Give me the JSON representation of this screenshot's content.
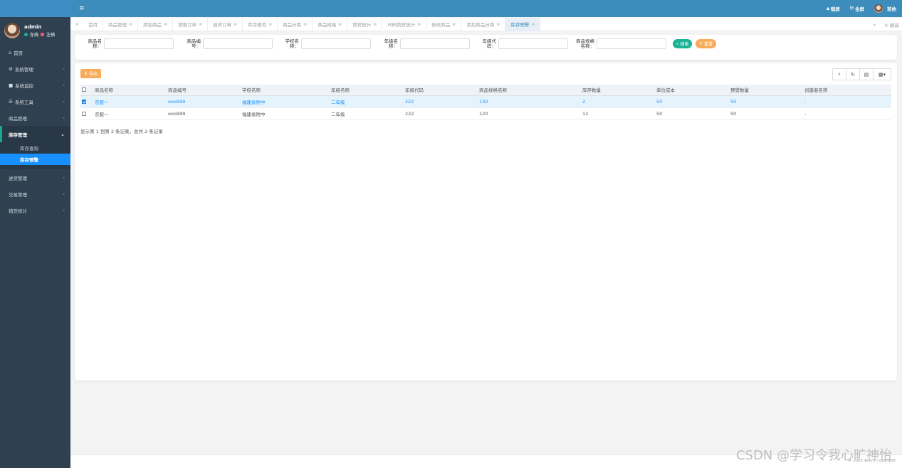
{
  "header": {
    "lock_label": "锁屏",
    "fullscreen_label": "全屏",
    "user_label": "若依"
  },
  "user": {
    "name": "admin",
    "status_online": "在线",
    "logout_label": "注销"
  },
  "sidebar": {
    "items": [
      {
        "icon": "home-icon",
        "label": "首页",
        "glyph": "⌂"
      },
      {
        "icon": "gear-icon",
        "label": "系统管理",
        "glyph": "⚙"
      },
      {
        "icon": "monitor-icon",
        "label": "系统监控",
        "glyph": "■"
      },
      {
        "icon": "tools-icon",
        "label": "系统工具",
        "glyph": "☰"
      },
      {
        "icon": "",
        "label": "商品管理",
        "glyph": ""
      },
      {
        "icon": "",
        "label": "库存管理",
        "glyph": ""
      },
      {
        "icon": "",
        "label": "进货管理",
        "glyph": ""
      },
      {
        "icon": "",
        "label": "交易管理",
        "glyph": ""
      },
      {
        "icon": "",
        "label": "销货统计",
        "glyph": ""
      }
    ],
    "sub_items": [
      "库存查询",
      "库存预警"
    ]
  },
  "tabs": {
    "items": [
      "首页",
      "商品管理",
      "添加商品",
      "销售订单",
      "退货订单",
      "库存查询",
      "商品分类",
      "商品规格",
      "销货统计",
      "尺码销货统计",
      "修改商品",
      "添加商品分类",
      "库存预警"
    ],
    "refresh_label": "刷新"
  },
  "search": {
    "fields": [
      {
        "label": "商品名称：",
        "value": ""
      },
      {
        "label": "商品编号：",
        "value": ""
      },
      {
        "label": "学校名称：",
        "value": ""
      },
      {
        "label": "年级名称：",
        "value": ""
      },
      {
        "label": "年级代码：",
        "value": ""
      },
      {
        "label": "商品规格名称：",
        "value": ""
      }
    ],
    "search_label": "搜索",
    "reset_label": "重置"
  },
  "table": {
    "export_label": "导出",
    "columns": [
      "商品名称",
      "商品编号",
      "学校名称",
      "年级名称",
      "年级代码",
      "商品规格名称",
      "库存数量",
      "单位成本",
      "预警数量",
      "创建者名称"
    ],
    "rows": [
      [
        "衣服一",
        "ooo999",
        "福建省附中",
        "二年级",
        "222",
        "130",
        "2",
        "50",
        "50",
        "-"
      ],
      [
        "衣服一",
        "ooo999",
        "福建省附中",
        "二年级",
        "222",
        "120",
        "12",
        "50",
        "50",
        "-"
      ]
    ],
    "pagination": "显示第 1 到第 2 条记录，总共 2 条记录"
  },
  "footer": {
    "copyright": "© 2021 RuoYi Copyright",
    "watermark": "CSDN @学习令我心旷神怡"
  },
  "colors": {
    "sidebar_bg": "#2f4050",
    "header_bg": "#3c8dbc",
    "active_blue": "#1890ff",
    "search_green": "#1ab394",
    "reset_orange": "#f8ac59"
  }
}
